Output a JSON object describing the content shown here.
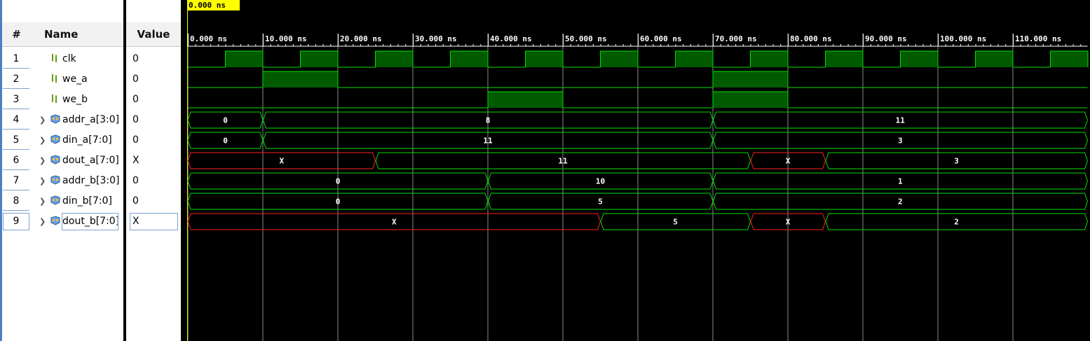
{
  "headers": {
    "num": "#",
    "name": "Name",
    "value": "Value"
  },
  "cursor_label": "0.000 ns",
  "time_axis": {
    "unit": "ns",
    "start": 0,
    "end": 120,
    "ticks": [
      {
        "t": 0,
        "label": "0.000 ns"
      },
      {
        "t": 10,
        "label": "10.000 ns"
      },
      {
        "t": 20,
        "label": "20.000 ns"
      },
      {
        "t": 30,
        "label": "30.000 ns"
      },
      {
        "t": 40,
        "label": "40.000 ns"
      },
      {
        "t": 50,
        "label": "50.000 ns"
      },
      {
        "t": 60,
        "label": "60.000 ns"
      },
      {
        "t": 70,
        "label": "70.000 ns"
      },
      {
        "t": 80,
        "label": "80.000 ns"
      },
      {
        "t": 90,
        "label": "90.000 ns"
      },
      {
        "t": 100,
        "label": "100.000 ns"
      },
      {
        "t": 110,
        "label": "110.000 ns"
      }
    ]
  },
  "colors": {
    "wave": "#00e000",
    "wave_fill": "#005a00",
    "undefined": "#ff2020",
    "grid": "#8a8a8a",
    "cursor": "#ffff00"
  },
  "signals": [
    {
      "num": "1",
      "name": "clk",
      "value": "0",
      "kind": "bit",
      "icon": "bit-signal-icon",
      "high_intervals": [
        [
          5,
          10
        ],
        [
          15,
          20
        ],
        [
          25,
          30
        ],
        [
          35,
          40
        ],
        [
          45,
          50
        ],
        [
          55,
          60
        ],
        [
          65,
          70
        ],
        [
          75,
          80
        ],
        [
          85,
          90
        ],
        [
          95,
          100
        ],
        [
          105,
          110
        ],
        [
          115,
          120
        ]
      ]
    },
    {
      "num": "2",
      "name": "we_a",
      "value": "0",
      "kind": "bit",
      "icon": "bit-signal-icon",
      "high_intervals": [
        [
          10,
          20
        ],
        [
          70,
          80
        ]
      ]
    },
    {
      "num": "3",
      "name": "we_b",
      "value": "0",
      "kind": "bit",
      "icon": "bit-signal-icon",
      "high_intervals": [
        [
          40,
          50
        ],
        [
          70,
          80
        ]
      ]
    },
    {
      "num": "4",
      "name": "addr_a[3:0]",
      "value": "0",
      "kind": "bus",
      "icon": "bus-signal-icon",
      "segments": [
        {
          "start": 0,
          "end": 10,
          "label": "0"
        },
        {
          "start": 10,
          "end": 70,
          "label": "8"
        },
        {
          "start": 70,
          "end": 120,
          "label": "11"
        }
      ]
    },
    {
      "num": "5",
      "name": "din_a[7:0]",
      "value": "0",
      "kind": "bus",
      "icon": "bus-signal-icon",
      "segments": [
        {
          "start": 0,
          "end": 10,
          "label": "0"
        },
        {
          "start": 10,
          "end": 70,
          "label": "11"
        },
        {
          "start": 70,
          "end": 120,
          "label": "3"
        }
      ]
    },
    {
      "num": "6",
      "name": "dout_a[7:0]",
      "value": "X",
      "kind": "bus",
      "icon": "bus-signal-icon",
      "segments": [
        {
          "start": 0,
          "end": 25,
          "label": "X",
          "undefined": true
        },
        {
          "start": 25,
          "end": 75,
          "label": "11"
        },
        {
          "start": 75,
          "end": 85,
          "label": "X",
          "undefined": true
        },
        {
          "start": 85,
          "end": 120,
          "label": "3"
        }
      ]
    },
    {
      "num": "7",
      "name": "addr_b[3:0]",
      "value": "0",
      "kind": "bus",
      "icon": "bus-signal-icon",
      "segments": [
        {
          "start": 0,
          "end": 40,
          "label": "0"
        },
        {
          "start": 40,
          "end": 70,
          "label": "10"
        },
        {
          "start": 70,
          "end": 120,
          "label": "1"
        }
      ]
    },
    {
      "num": "8",
      "name": "din_b[7:0]",
      "value": "0",
      "kind": "bus",
      "icon": "bus-signal-icon",
      "segments": [
        {
          "start": 0,
          "end": 40,
          "label": "0"
        },
        {
          "start": 40,
          "end": 70,
          "label": "5"
        },
        {
          "start": 70,
          "end": 120,
          "label": "2"
        }
      ]
    },
    {
      "num": "9",
      "name": "dout_b[7:0]",
      "value": "X",
      "kind": "bus",
      "icon": "bus-signal-icon",
      "selected": true,
      "segments": [
        {
          "start": 0,
          "end": 55,
          "label": "X",
          "undefined": true
        },
        {
          "start": 55,
          "end": 75,
          "label": "5"
        },
        {
          "start": 75,
          "end": 85,
          "label": "X",
          "undefined": true
        },
        {
          "start": 85,
          "end": 120,
          "label": "2"
        }
      ]
    }
  ]
}
